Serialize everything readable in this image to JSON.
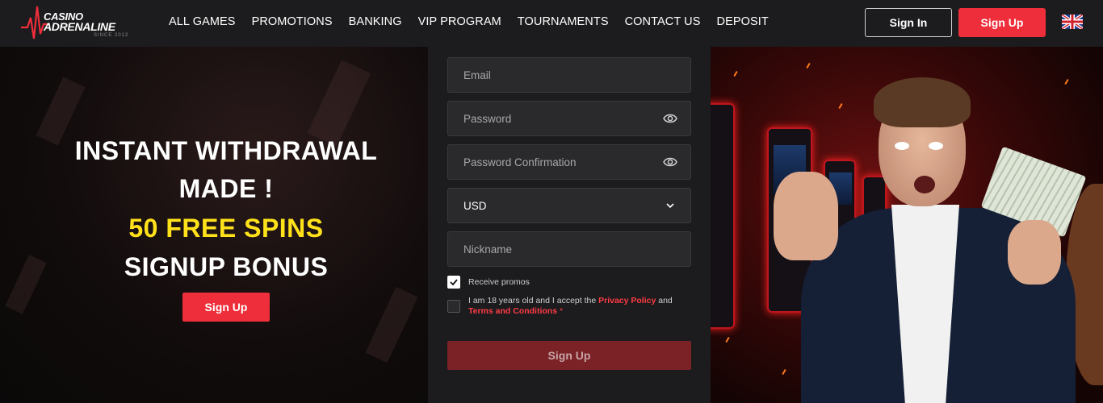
{
  "brand": {
    "line1": "CASINO",
    "line2": "ADRENALINE",
    "tagline": "SINCE 2012"
  },
  "nav": {
    "items": [
      "ALL GAMES",
      "PROMOTIONS",
      "BANKING",
      "VIP PROGRAM",
      "TOURNAMENTS",
      "CONTACT US",
      "DEPOSIT"
    ]
  },
  "header": {
    "sign_in": "Sign In",
    "sign_up": "Sign Up",
    "language_icon": "uk-flag-icon"
  },
  "hero": {
    "line1": "INSTANT WITHDRAWAL",
    "line2": "MADE !",
    "line3": "50 FREE SPINS",
    "line4": "SIGNUP BONUS",
    "button": "Sign Up"
  },
  "form": {
    "email_placeholder": "Email",
    "password_placeholder": "Password",
    "password_confirm_placeholder": "Password Confirmation",
    "currency": "USD",
    "nickname_placeholder": "Nickname",
    "receive_promos": "Receive promos",
    "receive_promos_checked": true,
    "age_text_before": "I am 18 years old and I accept the ",
    "privacy_policy": "Privacy Policy",
    "age_text_and": " and",
    "terms": "Terms and Conditions",
    "required_mark": " *",
    "age_checked": false,
    "submit": "Sign Up"
  },
  "colors": {
    "accent": "#ee2e3a",
    "highlight": "#ffe21a",
    "panel": "#1c1c1e"
  }
}
